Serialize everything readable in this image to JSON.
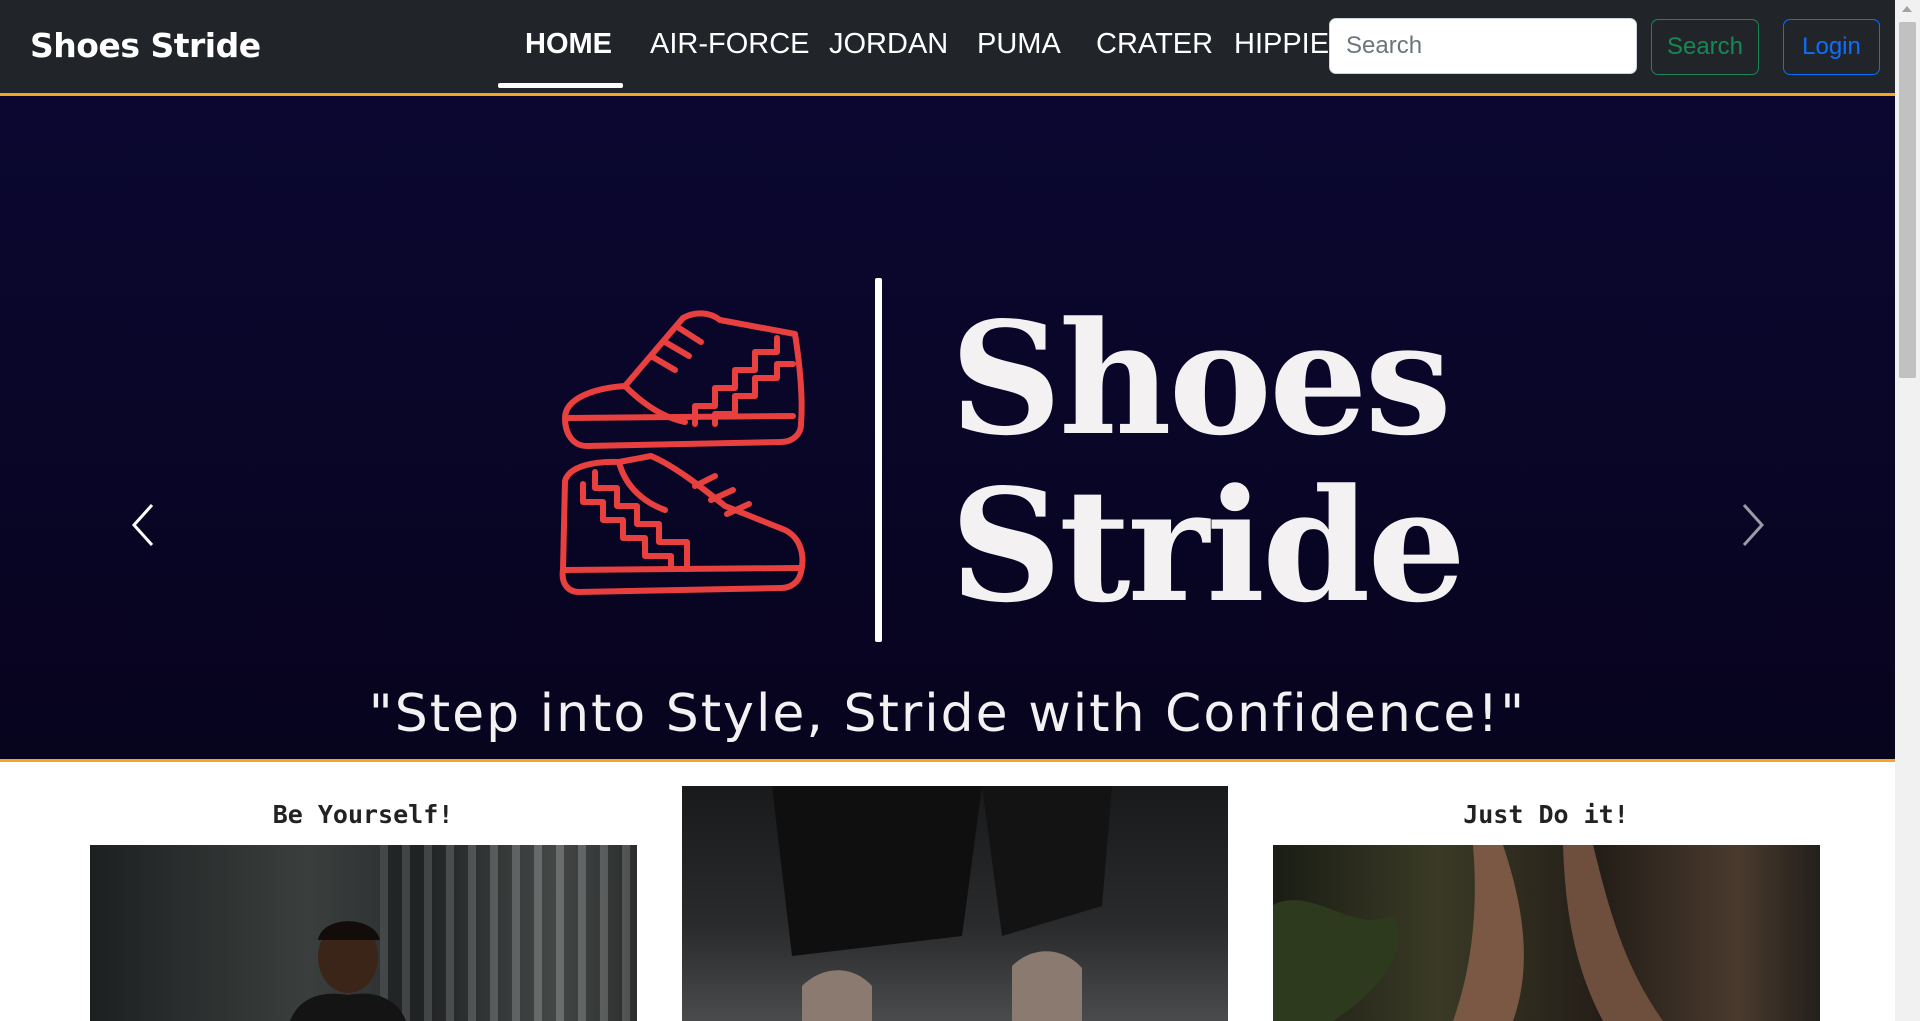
{
  "header": {
    "brand": "Shoes Stride",
    "nav": [
      {
        "label": "HOME",
        "active": true
      },
      {
        "label": "AIR-FORCE",
        "active": false
      },
      {
        "label": "JORDAN",
        "active": false
      },
      {
        "label": "PUMA",
        "active": false
      },
      {
        "label": "CRATER",
        "active": false
      },
      {
        "label": "HIPPIE",
        "active": false
      }
    ],
    "search_placeholder": "Search",
    "search_button": "Search",
    "login_button": "Login"
  },
  "hero": {
    "title_line1": "Shoes",
    "title_line2": "Stride",
    "tagline": "\"Step into Style, Stride with Confidence!\"",
    "slide_count": 3,
    "active_slide": 1,
    "prev_icon": "chevron-left-icon",
    "next_icon": "chevron-right-icon"
  },
  "cards": [
    {
      "title": "Be Yourself!"
    },
    {
      "title": ""
    },
    {
      "title": "Just Do it!"
    }
  ],
  "colors": {
    "navbar_bg": "#212529",
    "accent_border": "#f5a623",
    "hero_bg": "#0b0731",
    "logo_red": "#e8403f",
    "search_btn": "#198754",
    "login_btn": "#0d6efd"
  }
}
